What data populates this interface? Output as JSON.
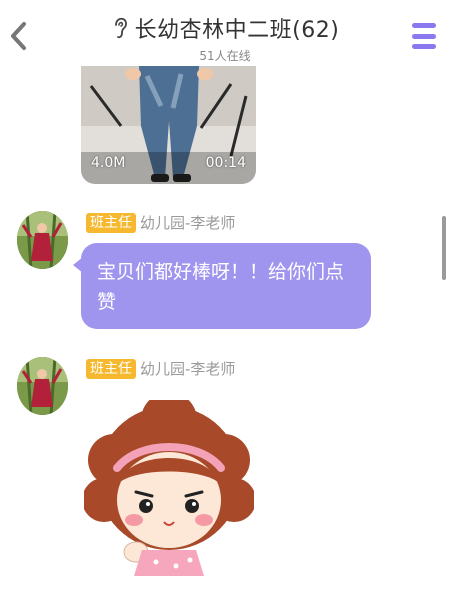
{
  "header": {
    "title": "长幼杏林中二班(62)",
    "subtitle": "51人在线"
  },
  "video": {
    "size": "4.0M",
    "duration": "00:14"
  },
  "messages": [
    {
      "role": "班主任",
      "sender": "幼儿园-李老师",
      "text": "宝贝们都好棒呀！！给你们点赞"
    },
    {
      "role": "班主任",
      "sender": "幼儿园-李老师",
      "sticker": "cartoon-girl-sticker"
    }
  ],
  "colors": {
    "accent": "#8a78ef",
    "bubble": "#9f95ef",
    "badge": "#f5b82e"
  }
}
